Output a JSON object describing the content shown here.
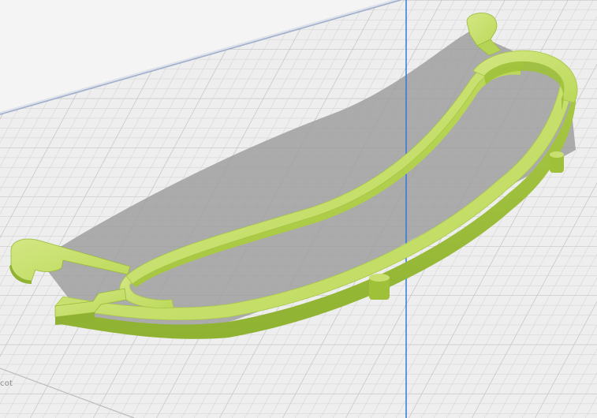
{
  "viewport": {
    "corner_label": "cot"
  },
  "colors": {
    "background": "#f4f4f4",
    "build_plate": "#ececec",
    "grid_minor": "#c9c9c9",
    "grid_major": "#b3b3b3",
    "plate_border": "#7f8fb0",
    "axis_line": "#2f7bd7",
    "shadow": "#9a9a9a",
    "model_top": "#c8e06a",
    "model_side": "#9fc13a",
    "model_shade": "#86a52b"
  },
  "scene": {
    "model": "curved-shield-frame",
    "axis": "z-axis-line"
  }
}
